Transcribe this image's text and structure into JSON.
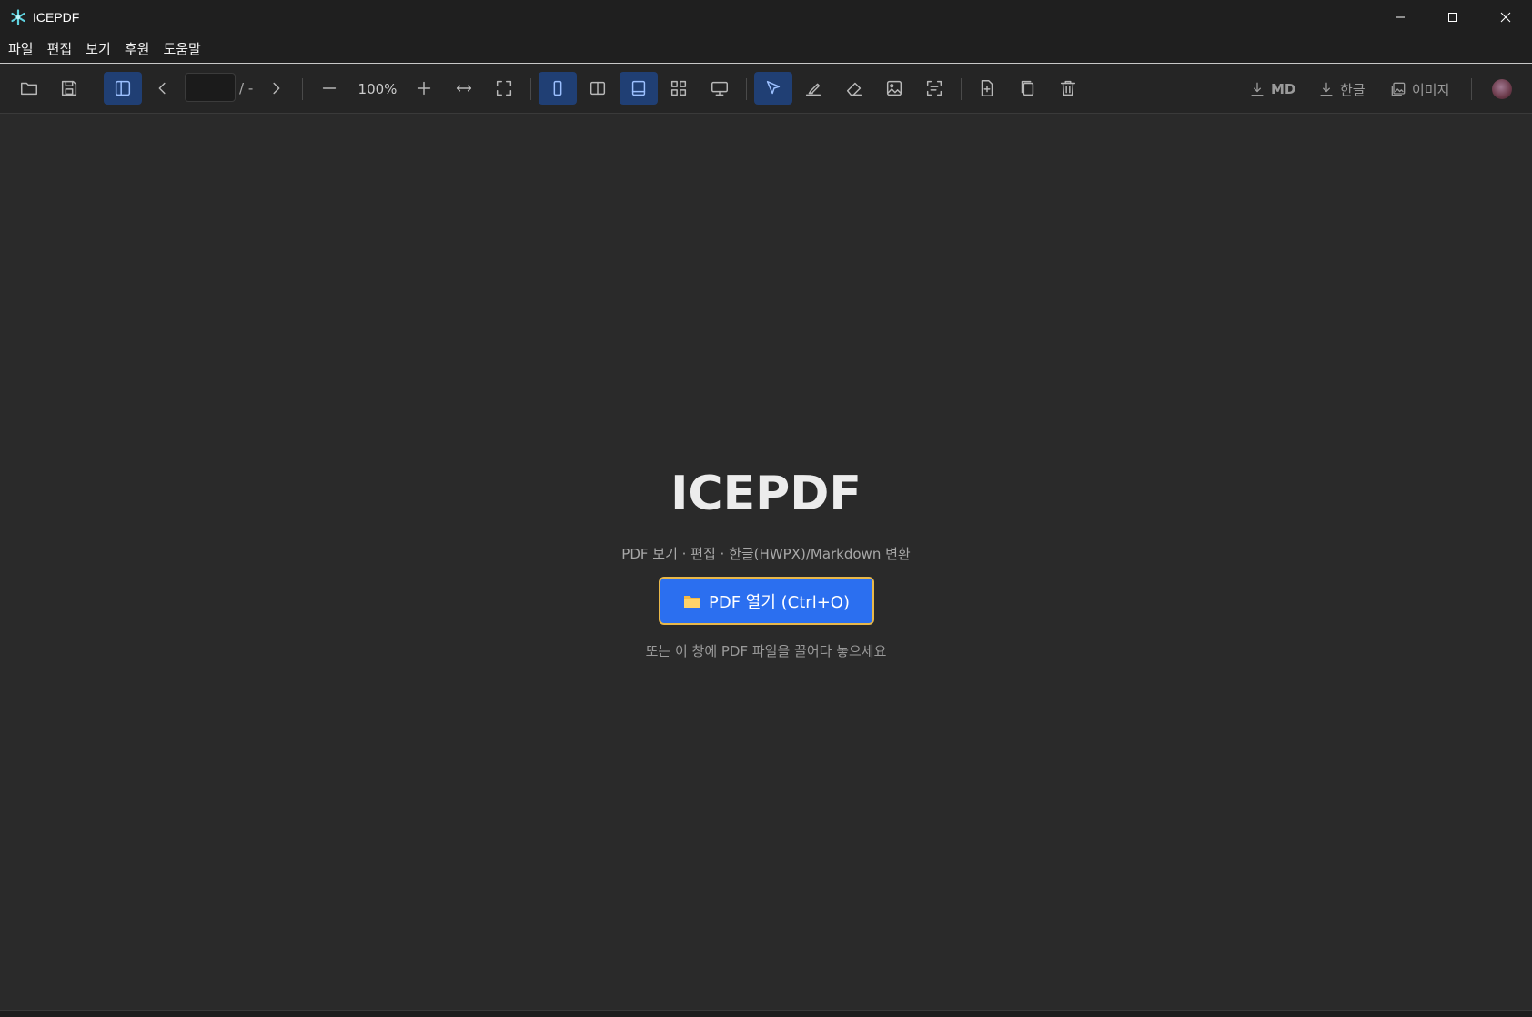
{
  "window": {
    "title": "ICEPDF"
  },
  "menu": {
    "items": [
      "파일",
      "편집",
      "보기",
      "후원",
      "도움말"
    ]
  },
  "toolbar": {
    "page_total": "/ -",
    "zoom": "100%",
    "exports": {
      "md": "MD",
      "hwp": "한글",
      "image": "이미지"
    }
  },
  "hero": {
    "title": "ICEPDF",
    "subtitle": "PDF 보기 · 편집 · 한글(HWPX)/Markdown 변환",
    "open_button": "PDF 열기 (Ctrl+O)",
    "hint": "또는 이 창에 PDF 파일을 끌어다 놓으세요"
  },
  "colors": {
    "accent": "#2b6ff0",
    "active_tool": "#203f74",
    "focus_ring": "#e8b84a"
  }
}
